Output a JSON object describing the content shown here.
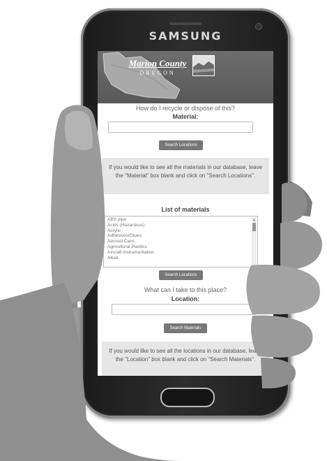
{
  "phone": {
    "brand": "SAMSUNG"
  },
  "header": {
    "logo_title": "Marion County",
    "logo_subtitle": "OREGON"
  },
  "material_search": {
    "question": "How do I recycle or dispose of this?",
    "label": "Material:",
    "input_value": "",
    "button_label": "Search Locations",
    "info": "If you would like to see all the materials in our database, leave the \"Material\" box blank and click on \"Search Locations\"."
  },
  "materials_list": {
    "heading": "List of materials",
    "items": [
      "ABS pipe",
      "Acids (Hazardous)",
      "Acrylic",
      "Adhesives/Glues",
      "Aerosol Cans",
      "Agricultural Plastics",
      "Aircraft instrumentation",
      "Alkali"
    ],
    "button_label": "Search Locations"
  },
  "location_search": {
    "question": "What can I take to this place?",
    "label": "Location:",
    "input_value": "",
    "button_label": "Search Materials",
    "info": "If you would like to see all the locations in our database, leave the \"Location\" box blank and click on \"Search Materials\"."
  },
  "colors": {
    "header_bg": "#5e5e5e",
    "button_bg": "#777777",
    "info_bg": "#e6e6e6"
  }
}
